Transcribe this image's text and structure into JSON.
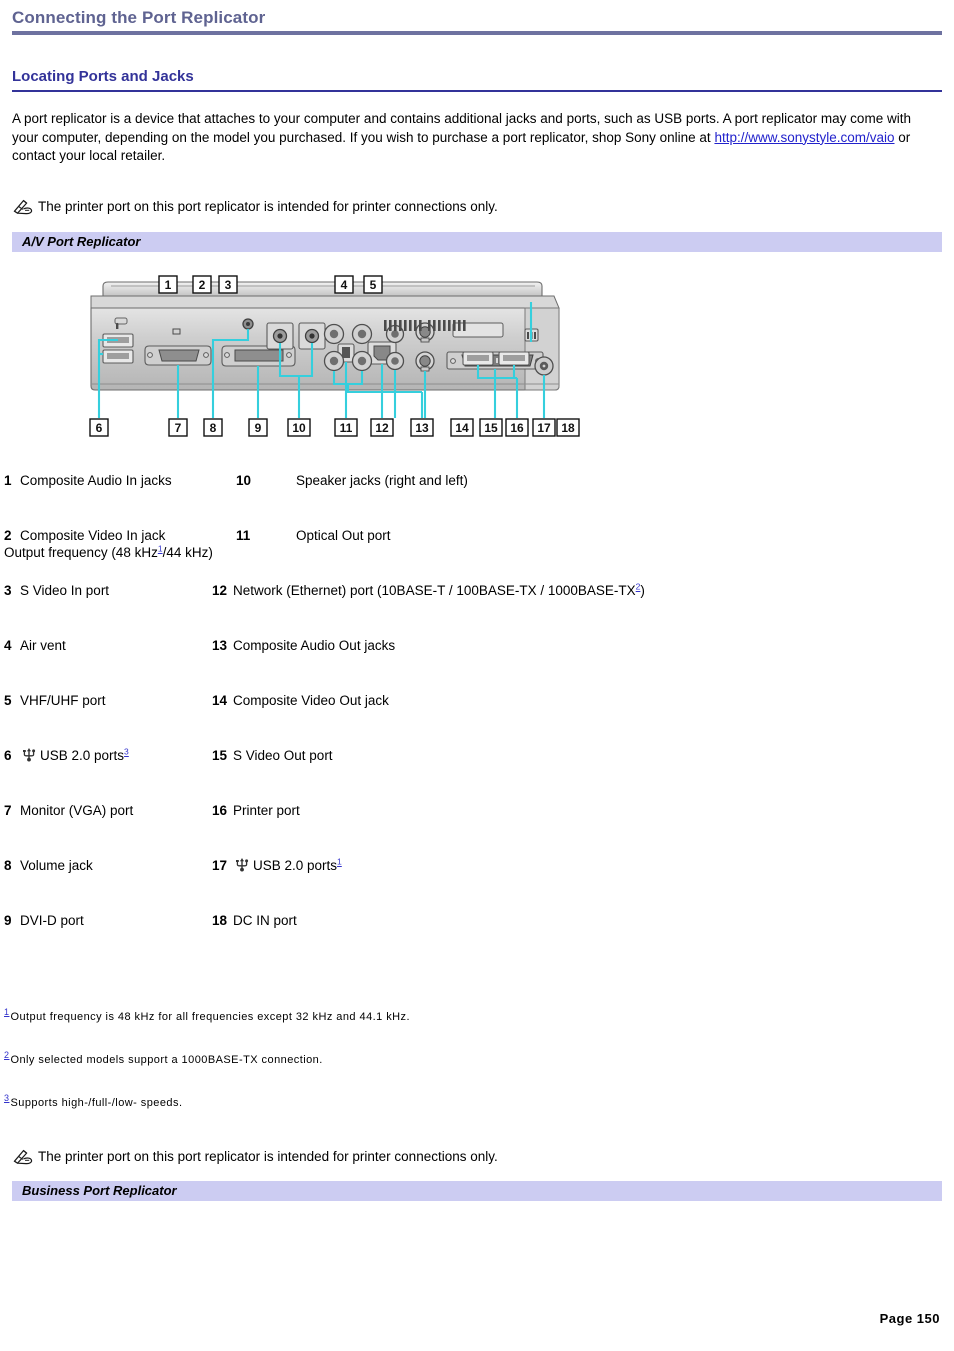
{
  "document": {
    "title": "Connecting the Port Replicator",
    "section_heading": "Locating Ports and Jacks",
    "page_number": "Page 150"
  },
  "intro": {
    "text_before_link": "A port replicator is a device that attaches to your computer and contains additional jacks and ports, such as USB ports. A port replicator may come with your computer, depending on the model you purchased. If you wish to purchase a port replicator, shop Sony online at ",
    "link_text": "http://www.sonystyle.com/vaio",
    "text_after_link": " or contact your local retailer."
  },
  "notes": {
    "printer_note": "The printer port on this port replicator is intended for printer connections only.",
    "icon": "note-pencil-icon"
  },
  "bands": {
    "av": "A/V Port Replicator",
    "business": "Business Port Replicator"
  },
  "diagram": {
    "name": "av-port-replicator-rear-panel",
    "callouts_top": [
      "1",
      "2",
      "3",
      "4",
      "5"
    ],
    "callouts_bottom": [
      "6",
      "7",
      "8",
      "9",
      "10",
      "11",
      "12",
      "13",
      "14",
      "15",
      "16",
      "17",
      "18"
    ],
    "leader_color": "#35cfdd",
    "body_color": "#c9c9c9"
  },
  "legend": {
    "rows": [
      {
        "left_num": "1",
        "left_text": "Composite Audio In jacks",
        "right_num": "10",
        "right_text": "Speaker jacks (right and left)"
      },
      {
        "left_num": "2",
        "left_text": "Composite Video In jack",
        "right_num": "11",
        "right_text": "Optical Out port",
        "sub_text_a": "Output frequency (48 kHz",
        "sub_fn": "1",
        "sub_text_b": "/44 kHz)"
      },
      {
        "left_num": "3",
        "left_text": "S Video In port",
        "right_num": "12",
        "right_text_a": "Network (Ethernet) port (10BASE-T / 100BASE-TX / 1000BASE-TX",
        "right_fn": "2",
        "right_text_b": ")"
      },
      {
        "left_num": "4",
        "left_text": "Air vent",
        "right_num": "13",
        "right_text": "Composite Audio Out jacks"
      },
      {
        "left_num": "5",
        "left_text": "VHF/UHF port",
        "right_num": "14",
        "right_text": "Composite Video Out jack"
      },
      {
        "left_num": "6",
        "left_icon": "usb-icon",
        "left_text": "USB 2.0 ports",
        "left_fn": "3",
        "right_num": "15",
        "right_text": "S Video Out port"
      },
      {
        "left_num": "7",
        "left_text": "Monitor (VGA) port",
        "right_num": "16",
        "right_text": "Printer port"
      },
      {
        "left_num": "8",
        "left_text": "Volume jack",
        "right_num": "17",
        "right_icon": "usb-icon",
        "right_text": "USB 2.0 ports",
        "right_fn": "1"
      },
      {
        "left_num": "9",
        "left_text": "DVI-D port",
        "right_num": "18",
        "right_text": "DC IN port"
      }
    ]
  },
  "footnotes": [
    {
      "mark": "1",
      "text": "Output frequency is 48 kHz for all frequencies except 32 kHz and 44.1 kHz."
    },
    {
      "mark": "2",
      "text": "Only selected models support a 1000BASE-TX connection."
    },
    {
      "mark": "3",
      "text": "Supports high-/full-/low- speeds."
    }
  ],
  "colors": {
    "title": "#5f6391",
    "heading": "#333399",
    "band": "#ccccf2",
    "link": "#2222cc"
  }
}
